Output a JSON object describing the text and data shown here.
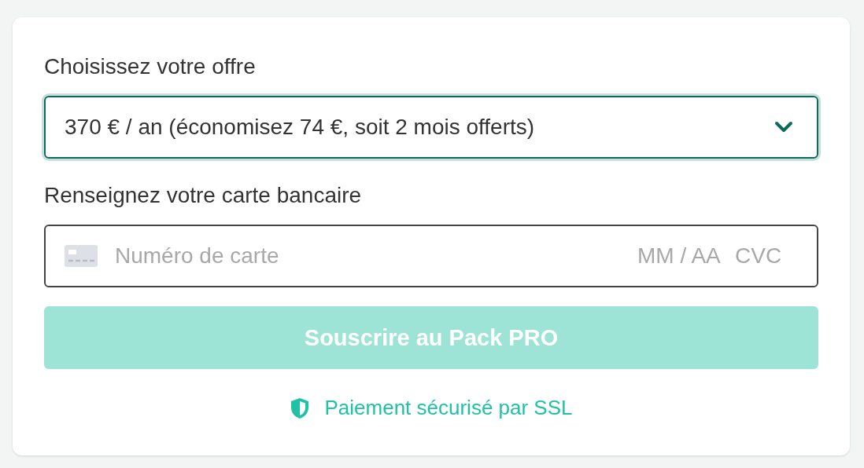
{
  "offer": {
    "label": "Choisissez votre offre",
    "value": "370 € / an (économisez 74 €, soit 2 mois offerts)"
  },
  "card": {
    "label": "Renseignez votre carte bancaire",
    "number_placeholder": "Numéro de carte",
    "expiry_placeholder": "MM / AA",
    "cvc_placeholder": "CVC"
  },
  "submit": {
    "label": "Souscrire au Pack PRO",
    "disabled": true
  },
  "security_note": "Paiement sécurisé par SSL"
}
